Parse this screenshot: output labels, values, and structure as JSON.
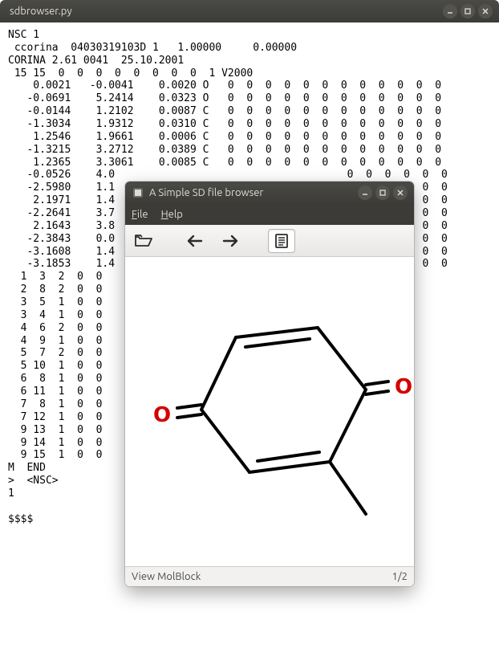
{
  "main_window": {
    "title": "sdbrowser.py"
  },
  "text_lines": [
    "NSC 1",
    " ccorina  04030319103D 1   1.00000     0.00000",
    "CORINA 2.61 0041  25.10.2001",
    " 15 15  0  0  0  0  0  0  0  0  1 V2000",
    "    0.0021   -0.0041    0.0020 O   0  0  0  0  0  0  0  0  0  0  0  0",
    "   -0.0691    5.2414    0.0323 O   0  0  0  0  0  0  0  0  0  0  0  0",
    "   -0.0144    1.2102    0.0087 C   0  0  0  0  0  0  0  0  0  0  0  0",
    "   -1.3034    1.9312    0.0310 C   0  0  0  0  0  0  0  0  0  0  0  0",
    "    1.2546    1.9661    0.0006 C   0  0  0  0  0  0  0  0  0  0  0  0",
    "   -1.3215    3.2712    0.0389 C   0  0  0  0  0  0  0  0  0  0  0  0",
    "    1.2365    3.3061    0.0085 C   0  0  0  0  0  0  0  0  0  0  0  0",
    "   -0.0526    4.0                                     0  0  0  0  0  0",
    "   -2.5980    1.1                                     0  0  0  0  0  0",
    "    2.1971    1.4                                     0  0  0  0  0  0",
    "   -2.2641    3.7                                     0  0  0  0  0  0",
    "    2.1643    3.8                                     0  0  0  0  0  0",
    "   -2.3843    0.0                                                 0  0",
    "   -3.1608    1.4                                     0  0  0  0  0  0",
    "   -3.1853    1.4                                     0  0  0  0  0  0",
    "  1  3  2  0  0",
    "  2  8  2  0  0",
    "  3  5  1  0  0",
    "  3  4  1  0  0",
    "  4  6  2  0  0",
    "  4  9  1  0  0",
    "  5  7  2  0  0",
    "  5 10  1  0  0",
    "  6  8  1  0  0",
    "  6 11  1  0  0",
    "  7  8  1  0  0",
    "  7 12  1  0  0",
    "  9 13  1  0  0",
    "  9 14  1  0  0",
    "  9 15  1  0  0",
    "M  END",
    ">  <NSC>",
    "1",
    "",
    "$$$$"
  ],
  "browser": {
    "title": "A Simple SD file browser",
    "menus": {
      "file": "File",
      "help": "Help"
    },
    "status_left": "View MolBlock",
    "status_right": "1/2"
  },
  "molecule": {
    "atoms": {
      "O_left": "O",
      "O_right": "O"
    }
  }
}
